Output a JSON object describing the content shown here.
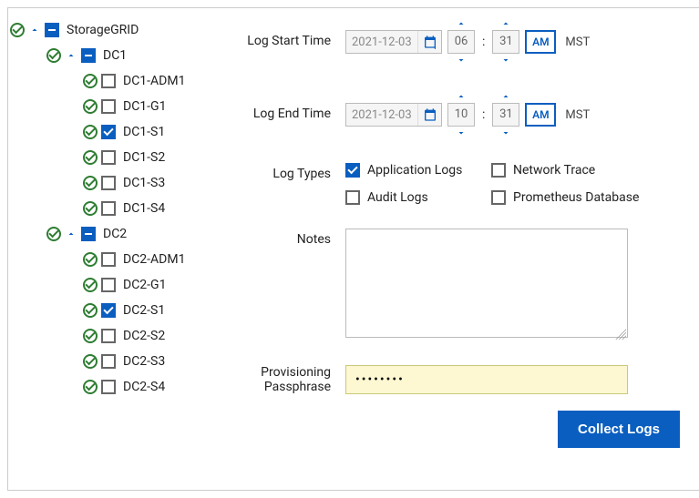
{
  "tree": {
    "root": {
      "label": "StorageGRID",
      "state": "indeterminate"
    },
    "dc1": {
      "label": "DC1",
      "state": "indeterminate",
      "children": [
        {
          "label": "DC1-ADM1",
          "checked": false
        },
        {
          "label": "DC1-G1",
          "checked": false
        },
        {
          "label": "DC1-S1",
          "checked": true
        },
        {
          "label": "DC1-S2",
          "checked": false
        },
        {
          "label": "DC1-S3",
          "checked": false
        },
        {
          "label": "DC1-S4",
          "checked": false
        }
      ]
    },
    "dc2": {
      "label": "DC2",
      "state": "indeterminate",
      "children": [
        {
          "label": "DC2-ADM1",
          "checked": false
        },
        {
          "label": "DC2-G1",
          "checked": false
        },
        {
          "label": "DC2-S1",
          "checked": true
        },
        {
          "label": "DC2-S2",
          "checked": false
        },
        {
          "label": "DC2-S3",
          "checked": false
        },
        {
          "label": "DC2-S4",
          "checked": false
        }
      ]
    }
  },
  "form": {
    "start": {
      "label": "Log Start Time",
      "date": "2021-12-03",
      "hour": "06",
      "minute": "31",
      "ampm": "AM",
      "tz": "MST"
    },
    "end": {
      "label": "Log End Time",
      "date": "2021-12-03",
      "hour": "10",
      "minute": "31",
      "ampm": "AM",
      "tz": "MST"
    },
    "types": {
      "label": "Log Types",
      "application": {
        "label": "Application Logs",
        "checked": true
      },
      "network": {
        "label": "Network Trace",
        "checked": false
      },
      "audit": {
        "label": "Audit Logs",
        "checked": false
      },
      "prometheus": {
        "label": "Prometheus Database",
        "checked": false
      }
    },
    "notes": {
      "label": "Notes",
      "value": ""
    },
    "passphrase": {
      "label": "Provisioning Passphrase",
      "value": "••••••••"
    },
    "submit": "Collect Logs"
  }
}
